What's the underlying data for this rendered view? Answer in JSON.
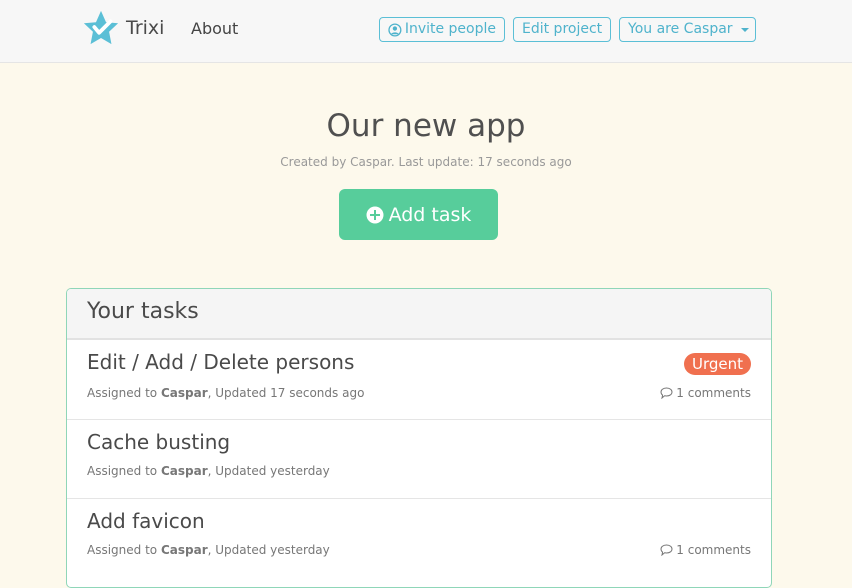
{
  "navbar": {
    "brand": "Trixi",
    "about": "About",
    "invite": "Invite people",
    "edit_project": "Edit project",
    "user_menu": "You are Caspar"
  },
  "project": {
    "title": "Our new app",
    "subtitle": "Created by Caspar. Last update: 17 seconds ago",
    "add_task": "Add task"
  },
  "tasks_panel": {
    "heading": "Your tasks",
    "assigned_prefix": "Assigned to",
    "tasks": [
      {
        "title": "Edit / Add / Delete persons",
        "assignee": "Caspar",
        "updated": ", Updated 17 seconds ago",
        "badge": "Urgent",
        "comments": "1 comments"
      },
      {
        "title": "Cache busting",
        "assignee": "Caspar",
        "updated": ", Updated yesterday"
      },
      {
        "title": "Add favicon",
        "assignee": "Caspar",
        "updated": ", Updated yesterday",
        "comments": "1 comments"
      }
    ]
  },
  "colors": {
    "accent": "#57cd9b",
    "nav_button": "#4fb3cc",
    "urgent": "#f0704f",
    "background": "#fdf9ec"
  }
}
